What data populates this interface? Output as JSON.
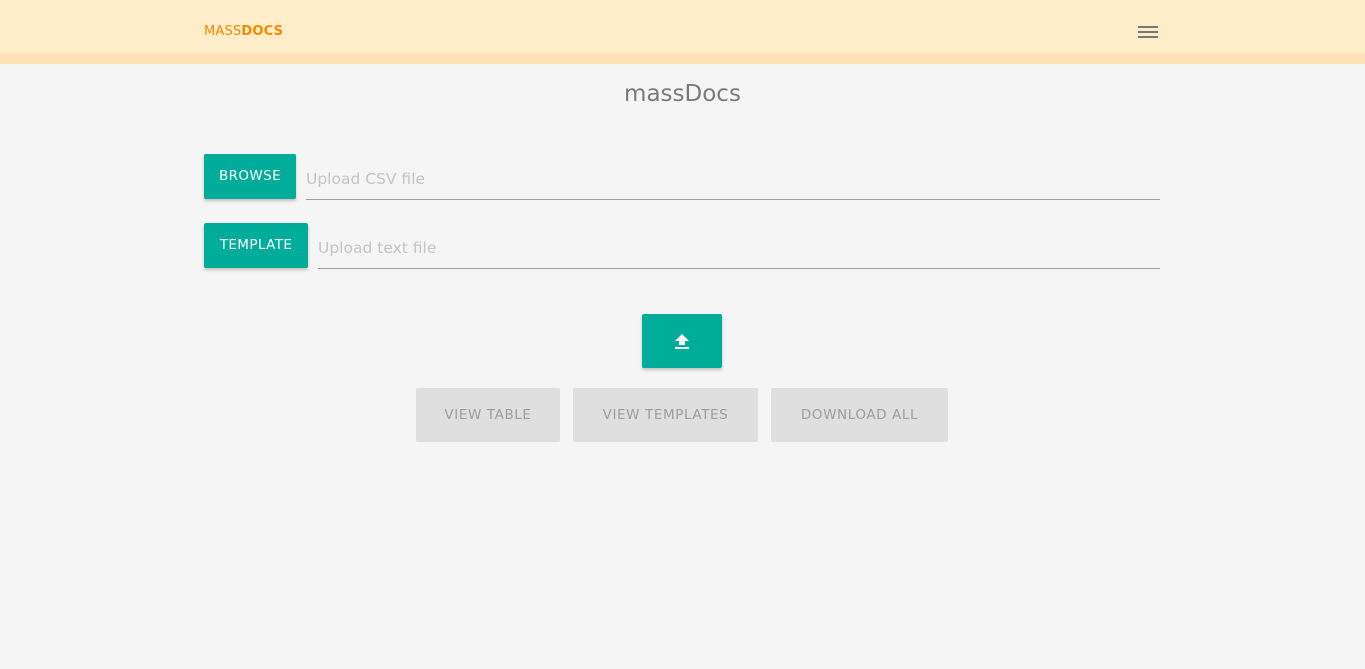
{
  "header": {
    "logo_light": "MASS",
    "logo_bold": "DOCS",
    "menu_icon": "hamburger-menu-icon",
    "background_color": "#ffecc9",
    "logo_color": "#f58a00"
  },
  "main": {
    "title": "massDocs",
    "csv_upload": {
      "button_label": "BROWSE",
      "placeholder": "Upload CSV file",
      "value": ""
    },
    "template_upload": {
      "button_label": "TEMPLATE",
      "placeholder": "Upload text file",
      "value": ""
    },
    "upload_button_icon": "upload-arrow-icon",
    "actions": {
      "view_table": "VIEW TABLE",
      "view_templates": "VIEW TEMPLATES",
      "download_all": "DOWNLOAD ALL"
    },
    "accent_color": "#00ac9a",
    "disabled_color": "#dfdfdf"
  }
}
